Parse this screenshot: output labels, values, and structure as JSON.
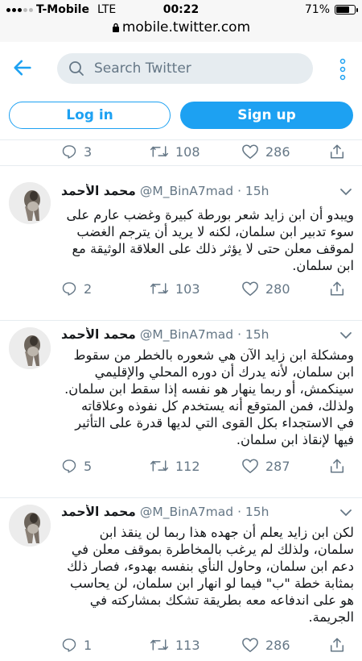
{
  "status": {
    "carrier": "T-Mobile",
    "network": "LTE",
    "time": "00:22",
    "battery": "71%",
    "battery_level": 0.71,
    "url": "mobile.twitter.com"
  },
  "header": {
    "search_placeholder": "Search Twitter"
  },
  "auth": {
    "login": "Log in",
    "signup": "Sign up"
  },
  "colors": {
    "accent": "#1da1f2",
    "muted": "#657786",
    "bg_search": "#e6ecf0"
  },
  "top_actions": {
    "replies": "3",
    "retweets": "108",
    "likes": "286"
  },
  "tweets": [
    {
      "name": "محمد الأحمد",
      "handle": "@M_BinA7mad",
      "time": "15h",
      "text": "ويبدو أن ابن زايد شعر بورطة كبيرة وغضب عارم على سوء تدبير ابن سلمان، لكنه لا يريد أن يترجم الغضب لموقف معلن حتى لا يؤثر ذلك على العلاقة الوثيقة مع ابن سلمان.",
      "replies": "2",
      "retweets": "103",
      "likes": "280"
    },
    {
      "name": "محمد الأحمد",
      "handle": "@M_BinA7mad",
      "time": "15h",
      "text": "ومشكلة ابن زايد الآن هي شعوره بالخطر من سقوط ابن سلمان، لأنه يدرك أن دوره المحلي والإقليمي سينكمش، أو ربما ينهار هو نفسه إذا سقط ابن سلمان. ولذلك، فمن المتوقع أنه يستخدم كل نفوذه وعلاقاته في الاستجداء بكل القوى التي لديها قدرة على التأثير فيها لإنقاذ ابن سلمان.",
      "replies": "5",
      "retweets": "112",
      "likes": "287"
    },
    {
      "name": "محمد الأحمد",
      "handle": "@M_BinA7mad",
      "time": "15h",
      "text": "لكن ابن زايد يعلم أن جهده هذا ربما لن ينقذ ابن سلمان، ولذلك لم يرغب بالمخاطرة بموقف معلن في دعم ابن سلمان، وحاول النأي بنفسه بهدوء، فصار ذلك بمثابة خطة \"ب\" فيما لو انهار ابن سلمان، لن يحاسب هو على اندفاعه معه بطريقة تشكك بمشاركته في الجريمة.",
      "replies": "1",
      "retweets": "113",
      "likes": "286"
    }
  ]
}
